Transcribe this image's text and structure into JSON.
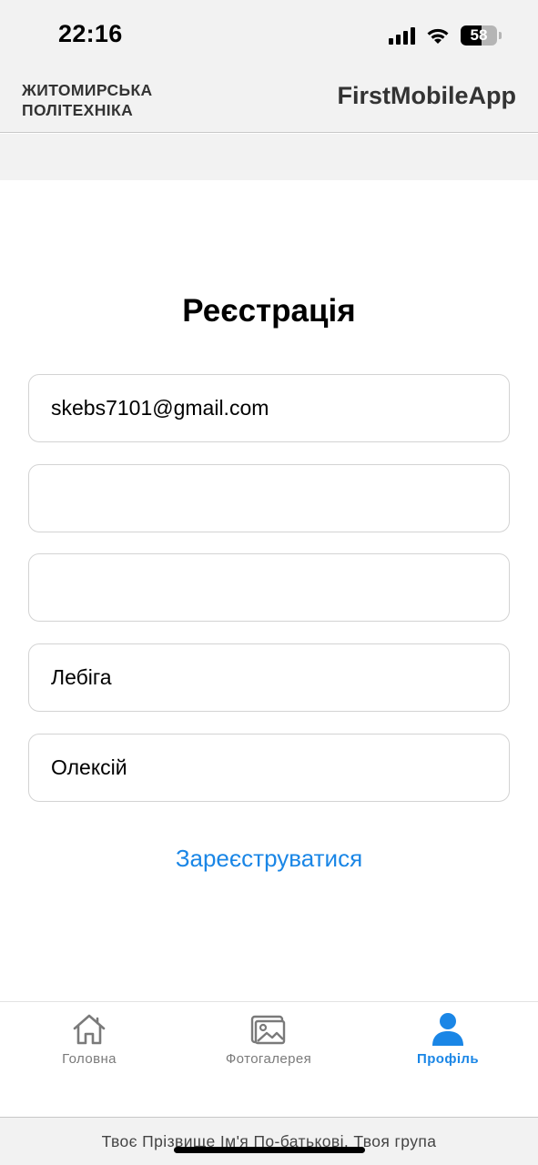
{
  "status_bar": {
    "time": "22:16",
    "battery_level": "58",
    "battery_fraction": 0.58,
    "icons": [
      "signal-icon",
      "wifi-icon",
      "battery-icon"
    ]
  },
  "header": {
    "logo_line1": "ЖИТОМИРСЬКА",
    "logo_line2": "ПОЛІТЕХНІКА",
    "app_title": "FirstMobileApp"
  },
  "form": {
    "title": "Реєстрація",
    "fields": [
      {
        "value": "skebs7101@gmail.com",
        "placeholder": ""
      },
      {
        "value": "",
        "placeholder": ""
      },
      {
        "value": "",
        "placeholder": ""
      },
      {
        "value": "Лебіга",
        "placeholder": ""
      },
      {
        "value": "Олексій",
        "placeholder": ""
      }
    ],
    "submit_label": "Зареєструватися"
  },
  "tabs": [
    {
      "label": "Головна",
      "icon": "home-icon",
      "active": false
    },
    {
      "label": "Фотогалерея",
      "icon": "gallery-icon",
      "active": false
    },
    {
      "label": "Профіль",
      "icon": "profile-icon",
      "active": true
    }
  ],
  "colors": {
    "accent": "#1a86e6",
    "inactive": "#7a7a7a",
    "header_bg": "#f2f2f2"
  },
  "footer": {
    "text": "Твоє Прізвище Ім'я По-батькові, Твоя група"
  }
}
